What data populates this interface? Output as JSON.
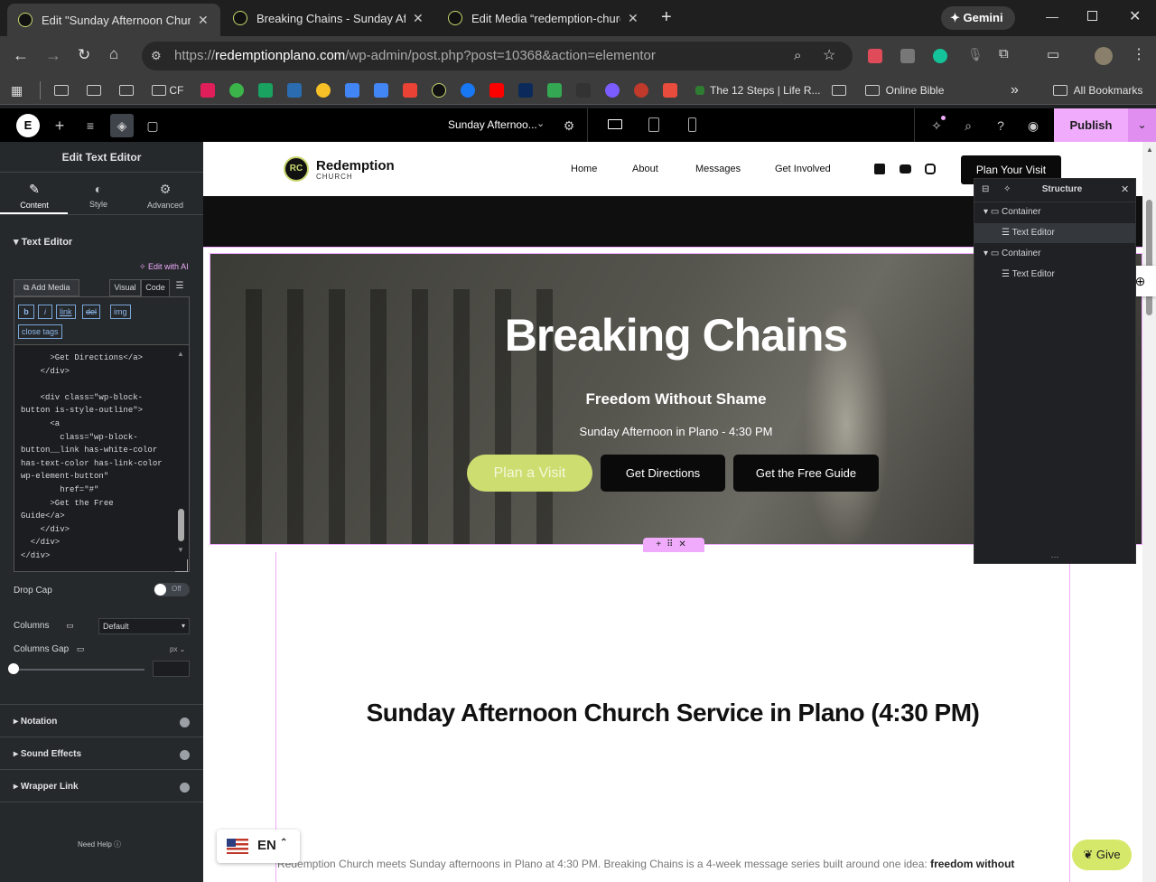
{
  "browser": {
    "tabs": [
      {
        "title": "Edit \"Sunday Afternoon Church",
        "close": "✕"
      },
      {
        "title": "Breaking Chains - Sunday Aftern",
        "close": "✕"
      },
      {
        "title": "Edit Media “redemption-church",
        "close": "✕"
      }
    ],
    "new_tab": "+",
    "gemini": "Gemini",
    "url_domain": "redemptionplano.com",
    "url_path": "/wp-admin/post.php?post=10368&action=elementor",
    "url_scheme": "https://",
    "bookmarks": {
      "cf": "CF",
      "twelve_steps": "The 12 Steps | Life R...",
      "online_bible": "Online Bible",
      "all_bookmarks": "All Bookmarks",
      "more": "»"
    }
  },
  "elementor": {
    "page_name": "Sunday Afternoo...",
    "publish": "Publish",
    "panel": {
      "title": "Edit Text Editor",
      "tabs": {
        "content": "Content",
        "style": "Style",
        "advanced": "Advanced"
      },
      "section": "Text Editor",
      "edit_ai": "Edit with AI",
      "add_media": "Add Media",
      "visual": "Visual",
      "code": "Code",
      "quicktags": [
        "b",
        "i",
        "link",
        "del",
        "img",
        "close tags"
      ],
      "code_lines": "      >Get Directions</a>\n    </div>\n\n    <div class=\"wp-block-\nbutton is-style-outline\">\n      <a\n        class=\"wp-block-\nbutton__link has-white-color\nhas-text-color has-link-color\nwp-element-button\"\n        href=\"#\"\n      >Get the Free\nGuide</a>\n    </div>\n  </div>\n</div>\n</div>",
      "drop_cap": "Drop Cap",
      "toggle_off": "Off",
      "columns": "Columns",
      "columns_value": "Default",
      "columns_gap": "Columns Gap",
      "unit": "px",
      "notation": "Notation",
      "sound_effects": "Sound Effects",
      "wrapper_link": "Wrapper Link",
      "need_help": "Need Help"
    },
    "structure": {
      "title": "Structure",
      "items": [
        {
          "label": "Container"
        },
        {
          "label": "Text Editor"
        },
        {
          "label": "Container"
        },
        {
          "label": "Text Editor"
        }
      ]
    }
  },
  "site": {
    "logo_main": "Redemption",
    "logo_sub": "CHURCH",
    "nav": [
      "Home",
      "About",
      "Messages",
      "Get Involved"
    ],
    "cta": "Plan Your Visit",
    "hero": {
      "title": "Breaking Chains",
      "subtitle": "Freedom Without Shame",
      "time": "Sunday Afternoon in Plano - 4:30 PM",
      "buttons": [
        "Plan a Visit",
        "Get Directions",
        "Get the Free Guide"
      ]
    },
    "section_title": "Sunday Afternoon Church Service in Plano (4:30 PM)",
    "body_text": "Redemption Church meets Sunday afternoons in Plano at 4:30 PM. Breaking Chains is a 4-week message series built around one idea: ",
    "body_bold": "freedom without",
    "give": "Give",
    "lang": "EN"
  }
}
